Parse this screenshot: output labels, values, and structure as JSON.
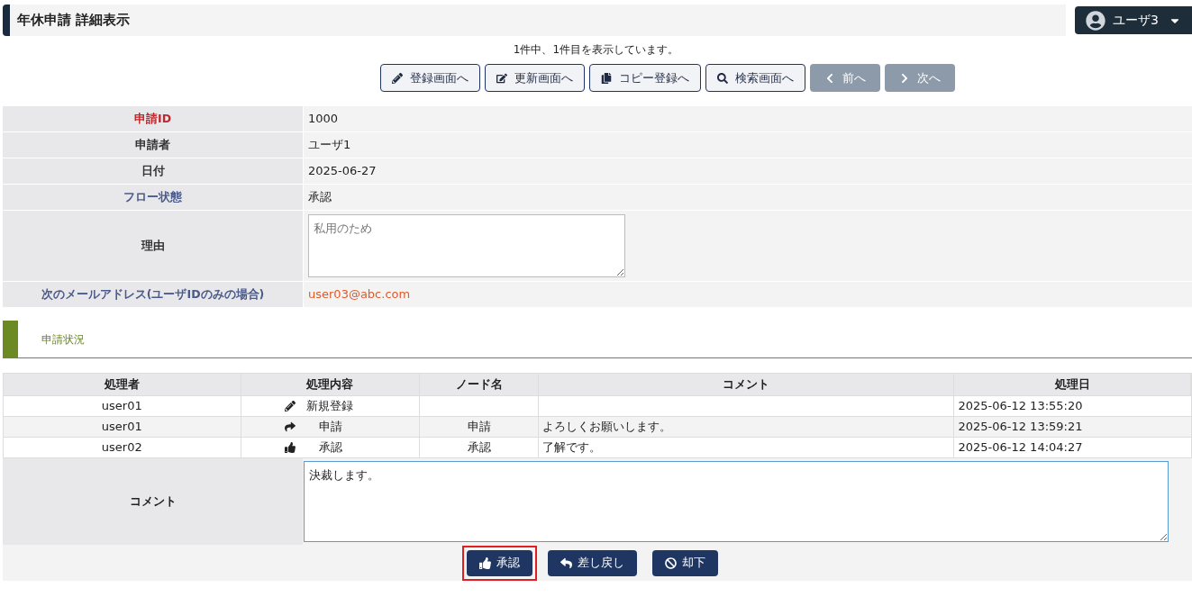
{
  "header": {
    "title": "年休申請 詳細表示",
    "user": "ユーザ3"
  },
  "record_count": "1件中、1件目を表示しています。",
  "nav_buttons": [
    {
      "kind": "register",
      "label": "登録画面へ",
      "disabled": false
    },
    {
      "kind": "update",
      "label": "更新画面へ",
      "disabled": false
    },
    {
      "kind": "copy",
      "label": "コピー登録へ",
      "disabled": false
    },
    {
      "kind": "search",
      "label": "検索画面へ",
      "disabled": false
    },
    {
      "kind": "prev",
      "label": "前へ",
      "disabled": true
    },
    {
      "kind": "next",
      "label": "次へ",
      "disabled": true
    }
  ],
  "details": [
    {
      "label": "申請ID",
      "color": "#c0282d",
      "kind": "text",
      "value": "1000"
    },
    {
      "label": "申請者",
      "color": "#333333",
      "kind": "text",
      "value": "ユーザ1"
    },
    {
      "label": "日付",
      "color": "#333333",
      "kind": "text",
      "value": "2025-06-27"
    },
    {
      "label": "フロー状態",
      "color": "#4a5a8a",
      "kind": "text",
      "value": "承認"
    },
    {
      "label": "理由",
      "color": "#333333",
      "kind": "textarea",
      "value": "私用のため"
    },
    {
      "label": "次のメールアドレス(ユーザIDのみの場合)",
      "color": "#4a5a8a",
      "kind": "email",
      "value": "user03@abc.com"
    }
  ],
  "section": {
    "title": "申請状況"
  },
  "history": {
    "columns": [
      "処理者",
      "処理内容",
      "ノード名",
      "コメント",
      "処理日"
    ],
    "rows": [
      {
        "user": "user01",
        "kind": "create",
        "action": "新規登録",
        "node": "",
        "comment": "",
        "date": "2025-06-12 13:55:20"
      },
      {
        "user": "user01",
        "kind": "apply",
        "action": "申請",
        "node": "申請",
        "comment": "よろしくお願いします。",
        "date": "2025-06-12 13:59:21"
      },
      {
        "user": "user02",
        "kind": "approve",
        "action": "承認",
        "node": "承認",
        "comment": "了解です。",
        "date": "2025-06-12 14:04:27"
      }
    ]
  },
  "comment": {
    "label": "コメント",
    "value": "決裁します。"
  },
  "action_buttons": [
    {
      "kind": "approve",
      "label": "承認",
      "highlighted": true
    },
    {
      "kind": "return",
      "label": "差し戻し",
      "highlighted": false
    },
    {
      "kind": "reject",
      "label": "却下",
      "highlighted": false
    }
  ]
}
